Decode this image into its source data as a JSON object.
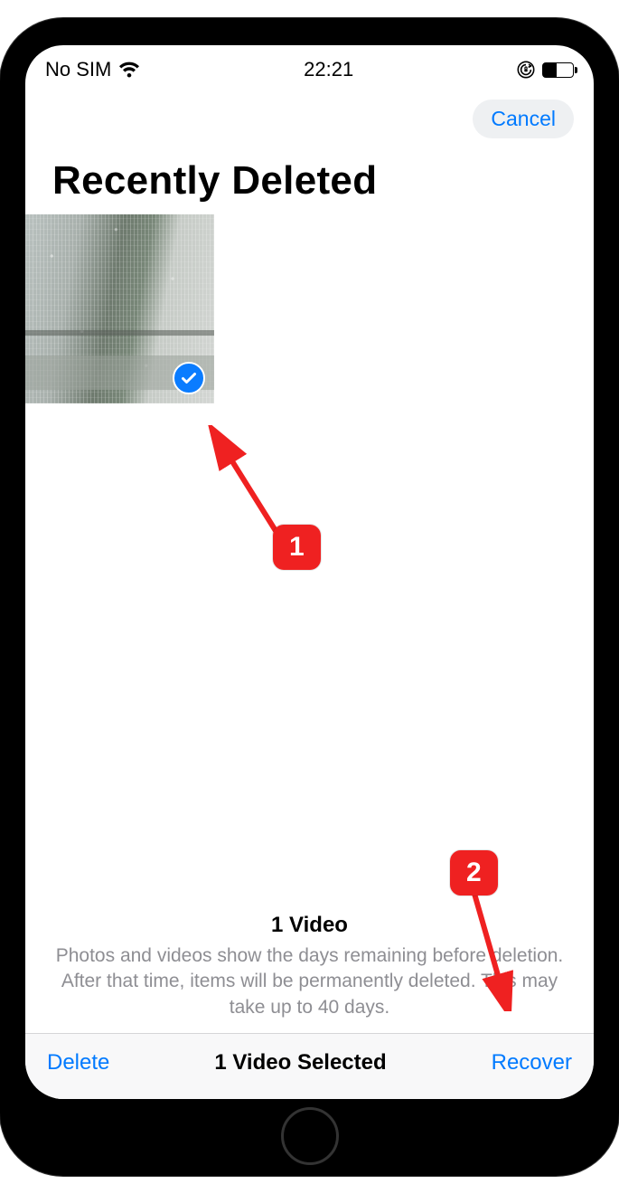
{
  "status": {
    "carrier": "No SIM",
    "time": "22:21"
  },
  "nav": {
    "cancel": "Cancel"
  },
  "page": {
    "title": "Recently Deleted"
  },
  "info": {
    "count": "1 Video",
    "description": "Photos and videos show the days remaining before deletion. After that time, items will be permanently deleted. This may take up to 40 days."
  },
  "toolbar": {
    "delete": "Delete",
    "status": "1 Video Selected",
    "recover": "Recover"
  },
  "annotations": {
    "a1": "1",
    "a2": "2"
  }
}
